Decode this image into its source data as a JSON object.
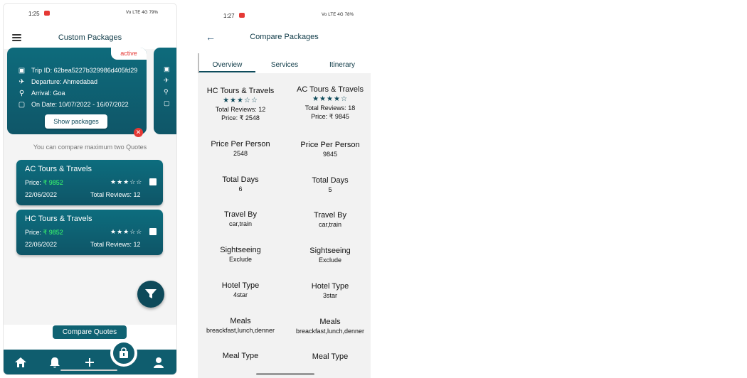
{
  "screen1": {
    "status": {
      "time": "1:25",
      "indicators": "Vo LTE 4G 79%"
    },
    "title": "Custom Packages",
    "trip": {
      "status": "active",
      "trip_id": "Trip ID: 62bea5227b329986d405fd29",
      "departure": "Departure: Ahmedabad",
      "arrival": "Arrival: Goa",
      "dates": "On Date: 10/07/2022 - 16/07/2022",
      "show_button": "Show packages"
    },
    "compare_note": "You can compare maximum two Quotes",
    "price_label": "Price:",
    "quotes": [
      {
        "name": "AC Tours & Travels",
        "price": "₹ 9852",
        "stars": "★★★☆☆",
        "rating": 3,
        "date": "22/06/2022",
        "reviews": "Total Reviews: 12"
      },
      {
        "name": "HC Tours & Travels",
        "price": "₹ 9852",
        "stars": "★★★☆☆",
        "rating": 3,
        "date": "22/06/2022",
        "reviews": "Total Reviews: 12"
      }
    ],
    "compare_button": "Compare Quotes",
    "nav_icons": [
      "home-icon",
      "bell-icon",
      "plus-icon",
      "shopping-bag-icon",
      "profile-icon"
    ]
  },
  "screen2": {
    "status": {
      "time": "1:27",
      "indicators": "Vo LTE 4G 78%"
    },
    "title": "Compare Packages",
    "tabs": [
      "Overview",
      "Services",
      "Itinerary"
    ],
    "packages": [
      {
        "name": "HC Tours & Travels",
        "stars": "★★★☆☆",
        "rating": 3,
        "reviews": "Total Reviews: 12",
        "price": "Price: ₹ 2548"
      },
      {
        "name": "AC Tours & Travels",
        "stars": "★★★★☆",
        "rating": 4,
        "reviews": "Total Reviews: 18",
        "price": "Price: ₹ 9845"
      }
    ],
    "attributes": [
      {
        "label": "Price Per Person",
        "values": [
          "2548",
          "9845"
        ]
      },
      {
        "label": "Total Days",
        "values": [
          "6",
          "5"
        ]
      },
      {
        "label": "Travel By",
        "values": [
          "car,train",
          "car,train"
        ]
      },
      {
        "label": "Sightseeing",
        "values": [
          "Exclude",
          "Exclude"
        ]
      },
      {
        "label": "Hotel Type",
        "values": [
          "4star",
          "3star"
        ]
      },
      {
        "label": "Meals",
        "values": [
          "breackfast,lunch,denner",
          "breackfast,lunch,denner"
        ]
      },
      {
        "label": "Meal Type",
        "values": [
          "",
          ""
        ]
      }
    ]
  },
  "colors": {
    "primary": "#0f5d6e",
    "accent_green": "#3dff6a",
    "badge_red": "#e53935"
  }
}
